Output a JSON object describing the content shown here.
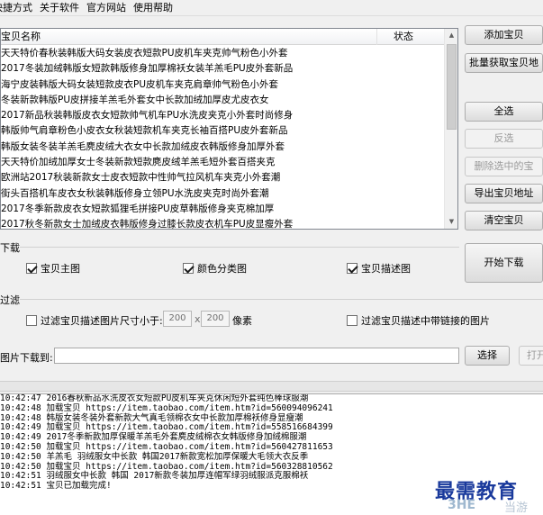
{
  "menu": {
    "items": [
      "快捷方式",
      "关于软件",
      "官方网站",
      "使用帮助"
    ]
  },
  "list": {
    "col_name": "宝贝名称",
    "col_status": "状态",
    "rows": [
      "天天特价春秋装韩版大码女装皮衣短款PU皮机车夹克帅气粉色小外套",
      "2017冬装加绒韩版女短款韩版修身加厚棉袄女装羊羔毛PU皮外套新品",
      "海宁皮装韩版大码女装短款皮衣PU皮机车夹克肩章帅气粉色小外套",
      "冬装新款韩版PU皮拼接羊羔毛外套女中长款加绒加厚皮尤皮衣女",
      "2017新品秋装韩版皮衣女短款帅气机车PU水洗皮夹克小外套时尚修身",
      "韩版帅气肩章粉色小皮衣女秋装短款机车夹克长袖百搭PU皮外套新品",
      "韩版女装冬装羊羔毛麂皮绒大衣女中长款加绒皮衣韩版修身加厚外套",
      "天天特价加绒加厚女士冬装新款短款麂皮绒羊羔毛短外套百搭夹克",
      "欧洲站2017秋装新款女士皮衣短款中性帅气拉风机车夹克小外套潮",
      "街头百搭机车皮衣女秋装韩版修身立领PU水洗皮夹克时尚外套潮",
      "2017冬季新款皮衣女短款狐狸毛拼接PU皮草韩版修身夹克棉加厚",
      "2017秋冬新款女士加绒皮衣韩版修身过膝长款皮衣机车PU皮显瘦外套"
    ]
  },
  "buttons": {
    "add": "添加宝贝",
    "batch": "批量获取宝贝地",
    "select_all": "全选",
    "invert": "反选",
    "delete_selected": "删除选中的宝",
    "export": "导出宝贝地址",
    "clear": "清空宝贝",
    "start": "开始下载",
    "choose": "选择",
    "open": "打开"
  },
  "download": {
    "label": "下载",
    "opt_main": "宝贝主图",
    "opt_color": "颜色分类图",
    "opt_desc": "宝贝描述图"
  },
  "filter": {
    "label": "过滤",
    "size_label": "过滤宝贝描述图片尺寸小于:",
    "width": "200",
    "x": "x",
    "height": "200",
    "unit": "像素",
    "link_label": "过滤宝贝描述中带链接的图片"
  },
  "path": {
    "label": "图片下载到:",
    "value": ""
  },
  "log": [
    "10:42:47 2016春秋新品水洗皮衣女短款PU皮机车夹克休闲短外套纯色棒球服潮",
    "10:42:48 加载宝贝 https://item.taobao.com/item.htm?id=560094096241",
    "10:42:48 韩版女装冬装外套新款大气真毛领棉衣女中长款加厚棉袄修身显瘦潮",
    "10:42:49 加载宝贝 https://item.taobao.com/item.htm?id=558516684399",
    "10:42:49 2017冬季新款加厚保暖羊羔毛外套麂皮绒棉衣女韩版修身加绒棉服潮",
    "10:42:50 加载宝贝 https://item.taobao.com/item.htm?id=560427811653",
    "10:42:50 羊羔毛 羽绒服女中长款 韩国2017新款宽松加厚保暖大毛领大衣反季",
    "10:42:50 加载宝贝 https://item.taobao.com/item.htm?id=560328810562",
    "10:42:51 羽绒服女中长款 韩国 2017新款冬装加厚连帽军绿羽绒服派克服棉袄",
    "10:42:51 宝贝已加载完成!"
  ],
  "watermark": {
    "text": "最需教育",
    "logo": "3HE",
    "sub": "当游"
  }
}
